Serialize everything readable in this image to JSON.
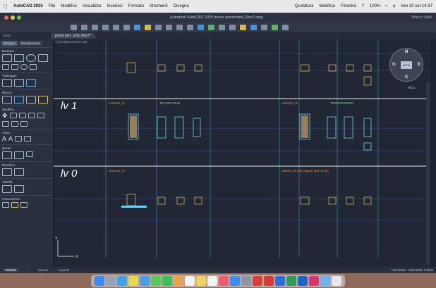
{
  "menubar": {
    "app": "AutoCAD 2025",
    "menus": [
      "File",
      "Modifica",
      "Visualizza",
      "Inserisci",
      "Formato",
      "Strumenti",
      "Disegna"
    ],
    "right_menus": [
      "Quotatura",
      "Modifica",
      "Finestra",
      "?"
    ],
    "battery": "100%",
    "clock": "Ven 20 set 14:37"
  },
  "window": {
    "title": "Autodesk AutoCAD 2025   prove serramenti_Rev7.dwg",
    "user": "Marco Vitali"
  },
  "tabs": {
    "home": "Inizio",
    "file_tab": "prove serr...enti_Rev7*"
  },
  "palette": {
    "tabs": [
      "Disegno",
      "Modellazione"
    ],
    "sections": [
      "Disegna",
      "Tratteggio",
      "Blocco",
      "Modifica",
      "Testo",
      "Quote",
      "Direttrice",
      "Tabella",
      "Parametrico"
    ]
  },
  "canvas": {
    "viewport_label": "[-][Alto][Wireframe 2D]",
    "levels": [
      "lv 1",
      "lv 0"
    ],
    "annotations": {
      "lv1_left": "145x318_ok",
      "lv1_left_green": "TR/ANDCOKIN",
      "lv1_right": "145x318_ok",
      "lv1_right_green": "T105ICOKINCON",
      "lv0_left": "102x142_ok",
      "lv0_right": "102x80_ok (tutte uguali, tutte ok 80)"
    },
    "navcube": {
      "face": "ALTO",
      "n": "N",
      "s": "S",
      "e": "E",
      "w": "O",
      "wcs": "WCS"
    }
  },
  "status": {
    "layouts": [
      "Modello",
      "+",
      "Layout1",
      "Layout2"
    ],
    "coords": "7644.8659, -1108.6094, 0.0000"
  },
  "colors": {
    "grid_cyan": "#3fb8d9",
    "grid_blue": "#4c6ad1",
    "level_line": "#f2f2f2",
    "note_orange": "#e08a2e",
    "note_green": "#7fe07f"
  }
}
